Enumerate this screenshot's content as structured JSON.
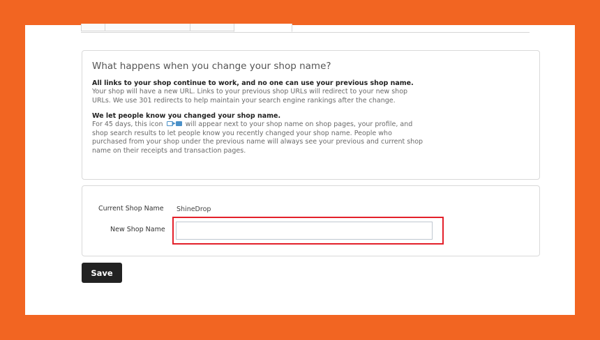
{
  "tabs": [
    {
      "label": ""
    },
    {
      "label": ""
    },
    {
      "label": ""
    },
    {
      "label": ""
    }
  ],
  "info": {
    "heading": "What happens when you change your shop name?",
    "section1_title": "All links to your shop continue to work, and no one can use your previous shop name.",
    "section1_body": "Your shop will have a new URL. Links to your previous shop URLs will redirect to your new shop URLs. We use 301 redirects to help maintain your search engine rankings after the change.",
    "section2_title": "We let people know you changed your shop name.",
    "section2_body_before": "For 45 days, this icon",
    "section2_body_after": "will appear next to your shop name on shop pages, your profile, and shop search results to let people know you recently changed your shop name. People who purchased from your shop under the previous name will always see your previous and current shop name on their receipts and transaction pages.",
    "icon": "shop-rename-icon"
  },
  "form": {
    "current_label": "Current Shop Name",
    "current_value": "ShineDrop",
    "new_label": "New Shop Name",
    "new_value": "",
    "new_placeholder": ""
  },
  "save_label": "Save",
  "colors": {
    "frame": "#f26522",
    "highlight": "#e3202a",
    "save_button": "#222222"
  }
}
